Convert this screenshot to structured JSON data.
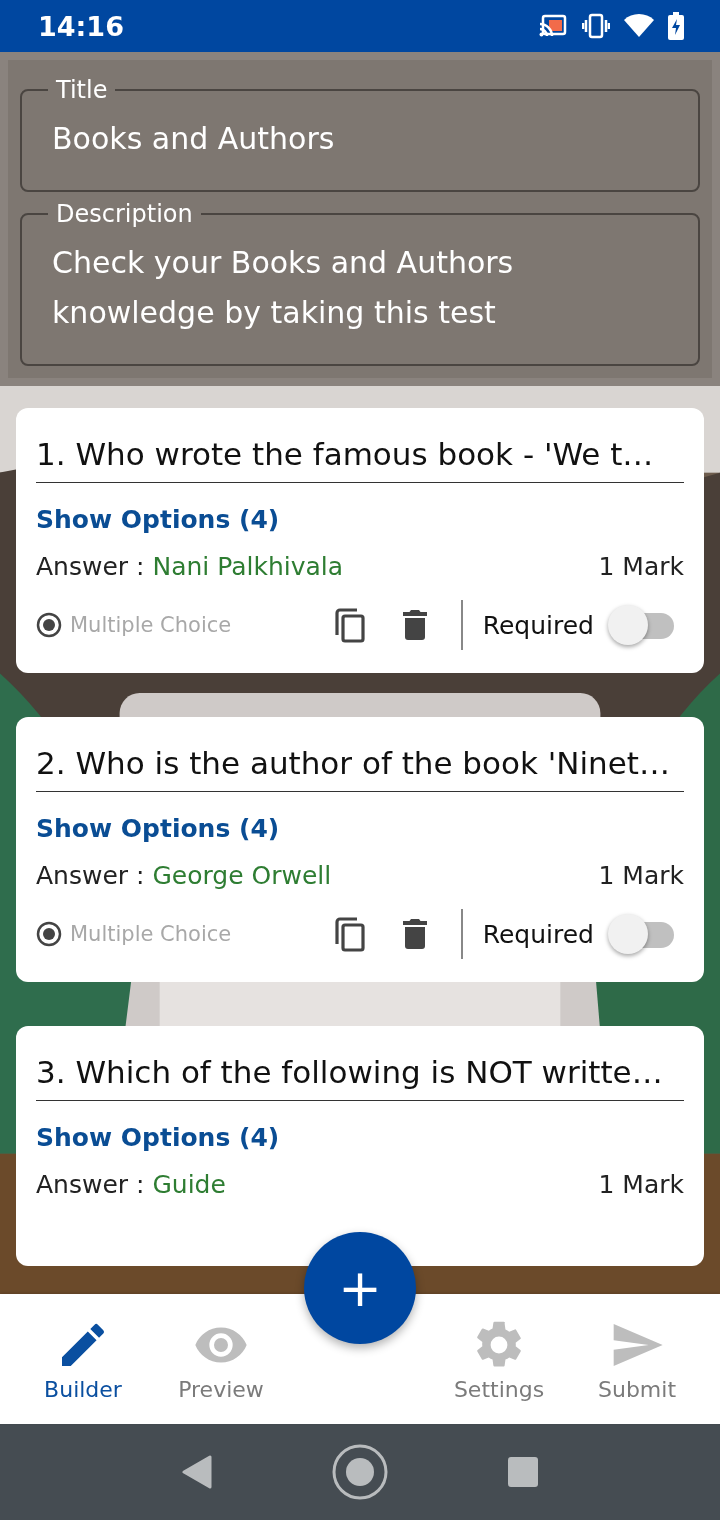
{
  "status_bar": {
    "time": "14:16"
  },
  "form": {
    "title": {
      "label": "Title",
      "value": "Books and Authors"
    },
    "description": {
      "label": "Description",
      "value": "Check your Books and Authors knowledge by taking this test"
    }
  },
  "questions": [
    {
      "text": "1. Who wrote the famous book - 'We t…",
      "options_link": "Show Options (4)",
      "answer_label": "Answer :",
      "answer": "Nani Palkhivala",
      "marks": "1 Mark",
      "footer": {
        "type": "Multiple Choice",
        "required_label": "Required",
        "required": false
      }
    },
    {
      "text": "2. Who is the author of the book 'Ninet…",
      "options_link": "Show Options (4)",
      "answer_label": "Answer :",
      "answer": "George Orwell",
      "marks": "1 Mark",
      "footer": {
        "type": "Multiple Choice",
        "required_label": "Required",
        "required": false
      }
    },
    {
      "text": "3. Which of the following is NOT writte…",
      "options_link": "Show Options (4)",
      "answer_label": "Answer :",
      "answer": "Guide",
      "marks": "1 Mark"
    }
  ],
  "bottom_nav": [
    {
      "kind": "builder",
      "label": "Builder",
      "selected": true
    },
    {
      "kind": "preview",
      "label": "Preview",
      "selected": false
    },
    {
      "kind": "settings",
      "label": "Settings",
      "selected": false
    },
    {
      "kind": "submit",
      "label": "Submit",
      "selected": false
    }
  ],
  "fab": {
    "label": "+"
  }
}
